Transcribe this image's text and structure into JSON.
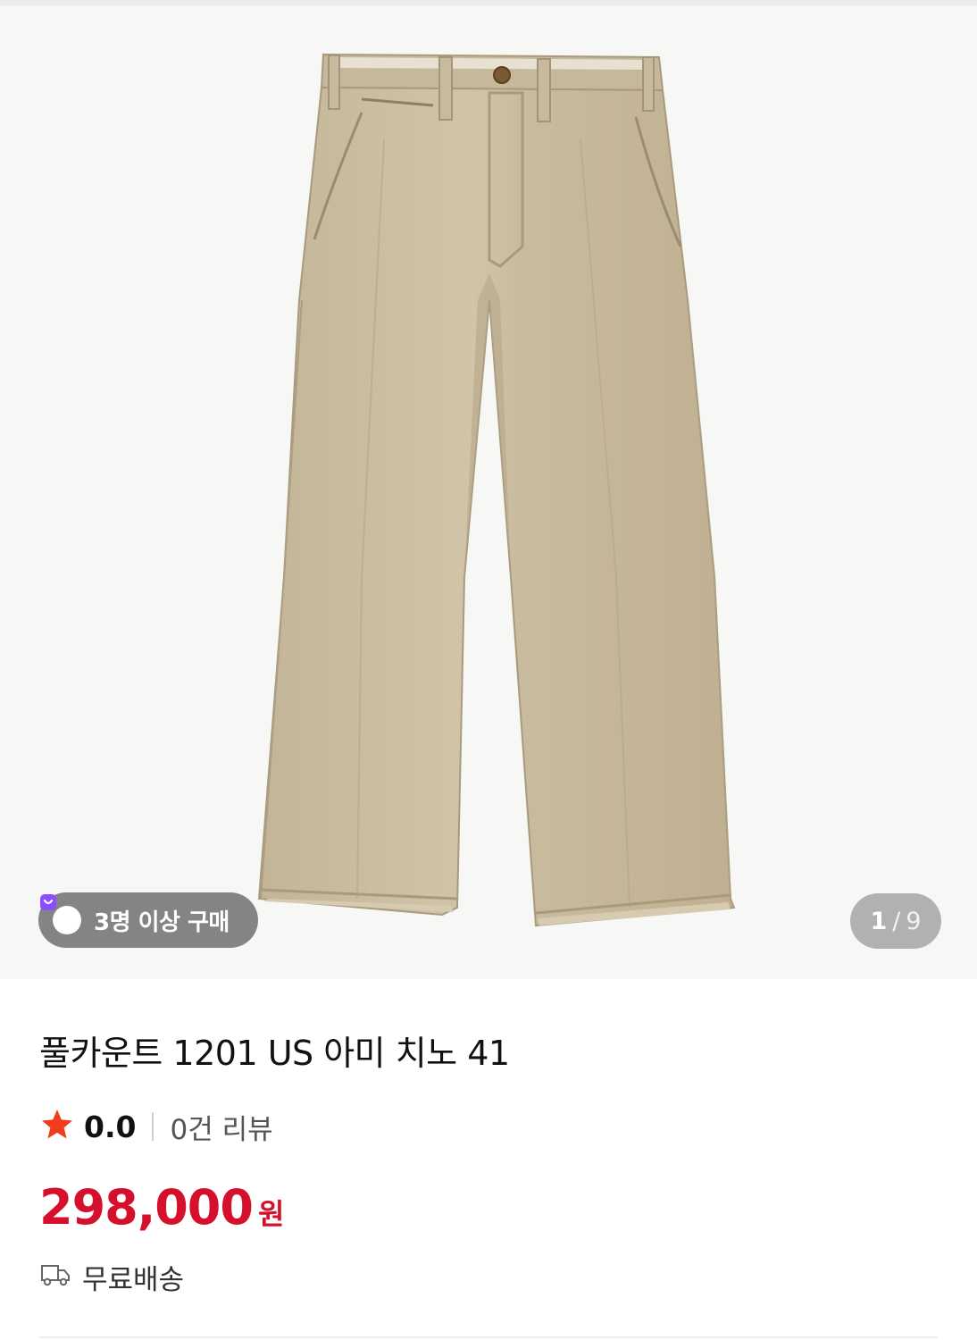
{
  "gallery": {
    "badge_label": "3명 이상 구매",
    "counter_current": "1",
    "counter_separator": "/",
    "counter_total": "9",
    "badge_color": "#8a4dff",
    "product_color": "#cbbd9f"
  },
  "product": {
    "title": "풀카운트 1201 US 아미 치노 41",
    "rating": "0.0",
    "review_count": "0건 리뷰",
    "price": "298,000",
    "currency": "원",
    "shipping": "무료배송",
    "price_color": "#d5102d",
    "star_color": "#f23c1d"
  }
}
